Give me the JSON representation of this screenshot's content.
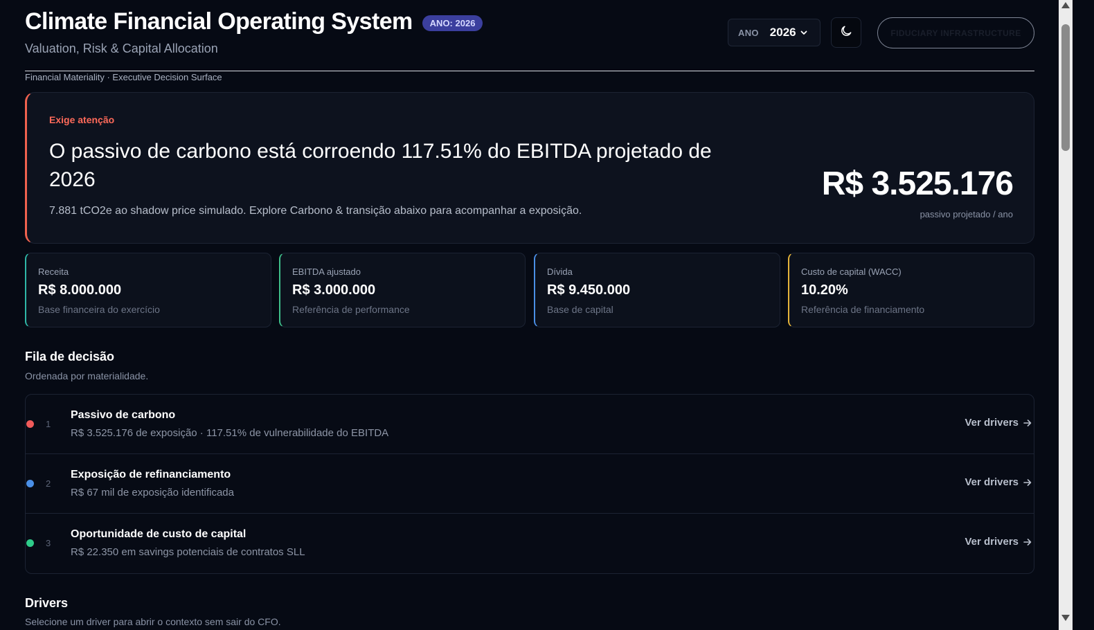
{
  "header": {
    "title": "Climate Financial Operating System",
    "year_badge": "ANO: 2026",
    "subtitle": "Valuation, Risk & Capital Allocation",
    "year_select_label": "ANO",
    "year_select_value": "2026",
    "fiduciary_button": "FIDUCIARY INFRASTRUCTURE",
    "breadcrumb": "Financial Materiality · Executive Decision Surface"
  },
  "alert": {
    "kicker": "Exige atenção",
    "headline": "O passivo de carbono está corroendo 117.51% do EBITDA projetado de 2026",
    "description": "7.881 tCO2e ao shadow price simulado. Explore Carbono & transição abaixo para acompanhar a exposição.",
    "amount": "R$ 3.525.176",
    "amount_label": "passivo projetado / ano",
    "accent_color": "#f0624f"
  },
  "kpis": [
    {
      "label": "Receita",
      "value": "R$ 8.000.000",
      "sub": "Base financeira do exercício",
      "accent": "#2fb8a8"
    },
    {
      "label": "EBITDA ajustado",
      "value": "R$ 3.000.000",
      "sub": "Referência de performance",
      "accent": "#3fbf8a"
    },
    {
      "label": "Dívida",
      "value": "R$ 9.450.000",
      "sub": "Base de capital",
      "accent": "#4a8fe6"
    },
    {
      "label": "Custo de capital (WACC)",
      "value": "10.20%",
      "sub": "Referência de financiamento",
      "accent": "#e6b43a"
    }
  ],
  "queue": {
    "title": "Fila de decisão",
    "subtitle": "Ordenada por materialidade.",
    "items": [
      {
        "num": "1",
        "title": "Passivo de carbono",
        "detail": "R$ 3.525.176 de exposição · 117.51% de vulnerabilidade do EBITDA",
        "link": "Ver drivers",
        "dot_color": "#f05a5a"
      },
      {
        "num": "2",
        "title": "Exposição de refinanciamento",
        "detail": "R$ 67 mil de exposição identificada",
        "link": "Ver drivers",
        "dot_color": "#4a8fe6"
      },
      {
        "num": "3",
        "title": "Oportunidade de custo de capital",
        "detail": "R$ 22.350 em savings potenciais de contratos SLL",
        "link": "Ver drivers",
        "dot_color": "#2ecc8a"
      }
    ]
  },
  "drivers": {
    "title": "Drivers",
    "subtitle": "Selecione um driver para abrir o contexto sem sair do CFO."
  },
  "icons": {
    "year_chevron": "chevron-down-icon",
    "theme": "moon-icon",
    "link_arrow": "arrow-right-icon"
  }
}
